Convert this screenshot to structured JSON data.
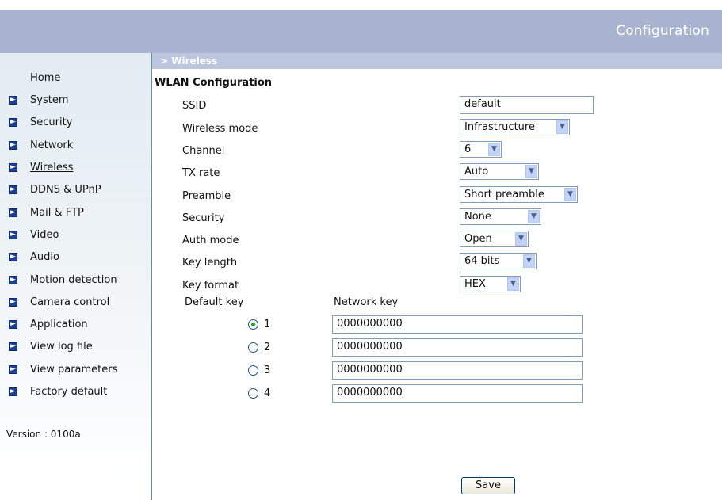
{
  "header": {
    "title": "Configuration"
  },
  "section": {
    "breadcrumb": "> Wireless",
    "heading": "WLAN Configuration"
  },
  "sidebar": {
    "items": [
      {
        "label": "Home",
        "arrow": false
      },
      {
        "label": "System",
        "arrow": true
      },
      {
        "label": "Security",
        "arrow": true
      },
      {
        "label": "Network",
        "arrow": true
      },
      {
        "label": "Wireless",
        "arrow": true,
        "active": true
      },
      {
        "label": "DDNS & UPnP",
        "arrow": true
      },
      {
        "label": "Mail & FTP",
        "arrow": true
      },
      {
        "label": "Video",
        "arrow": true
      },
      {
        "label": "Audio",
        "arrow": true
      },
      {
        "label": "Motion detection",
        "arrow": true
      },
      {
        "label": "Camera control",
        "arrow": true
      },
      {
        "label": "Application",
        "arrow": true
      },
      {
        "label": "View log file",
        "arrow": true
      },
      {
        "label": "View parameters",
        "arrow": true
      },
      {
        "label": "Factory default",
        "arrow": true
      }
    ],
    "version": "Version : 0100a"
  },
  "form": {
    "ssid": {
      "label": "SSID",
      "value": "default"
    },
    "wireless_mode": {
      "label": "Wireless mode",
      "value": "Infrastructure"
    },
    "channel": {
      "label": "Channel",
      "value": "6"
    },
    "tx_rate": {
      "label": "TX rate",
      "value": "Auto"
    },
    "preamble": {
      "label": "Preamble",
      "value": "Short preamble"
    },
    "security": {
      "label": "Security",
      "value": "None"
    },
    "auth_mode": {
      "label": "Auth mode",
      "value": "Open"
    },
    "key_length": {
      "label": "Key length",
      "value": "64 bits"
    },
    "key_format": {
      "label": "Key format",
      "value": "HEX"
    }
  },
  "keys": {
    "default_key_header": "Default key",
    "network_key_header": "Network key",
    "selected": 1,
    "rows": [
      {
        "num": "1",
        "value": "0000000000",
        "checked": true
      },
      {
        "num": "2",
        "value": "0000000000",
        "checked": false
      },
      {
        "num": "3",
        "value": "0000000000",
        "checked": false
      },
      {
        "num": "4",
        "value": "0000000000",
        "checked": false
      }
    ]
  },
  "buttons": {
    "save": "Save"
  },
  "icons": {
    "nav_arrow": "arrow-right-icon",
    "dropdown": "chevron-down-icon"
  },
  "colors": {
    "header_bg": "#a8b3d0",
    "section_bar_bg": "#bcc6de",
    "nav_arrow": "#1d3f91",
    "sidebar_border": "#5f8f9a"
  }
}
